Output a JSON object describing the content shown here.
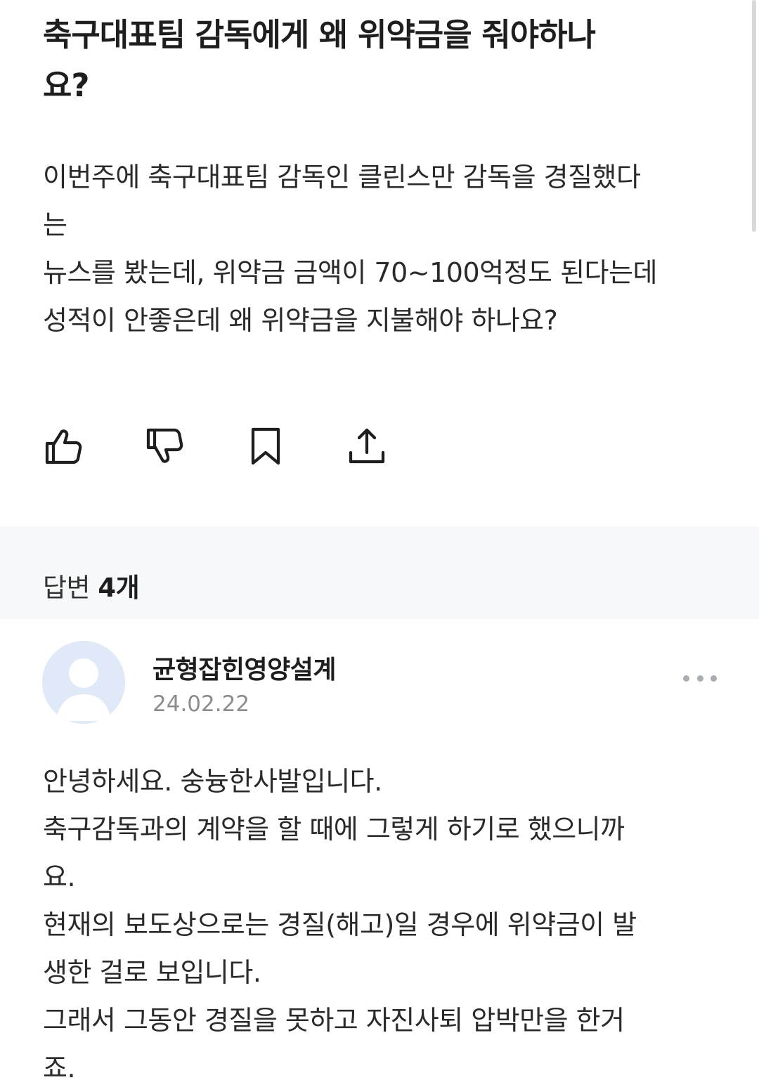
{
  "question": {
    "title_lines": [
      "축구대표팀 감독에게 왜 위약금을 줘야하나",
      "요?"
    ],
    "body_lines": [
      "이번주에 축구대표팀 감독인 클린스만 감독을 경질했다",
      "는",
      "뉴스를 봤는데, 위약금 금액이 70~100억정도 된다는데",
      "성적이 안좋은데 왜 위약금을 지불해야 하나요?"
    ]
  },
  "actions": {
    "like_icon": "thumbs-up-icon",
    "dislike_icon": "thumbs-down-icon",
    "bookmark_icon": "bookmark-icon",
    "share_icon": "share-icon"
  },
  "answers_header": {
    "label": "답변",
    "count": "4개"
  },
  "answer": {
    "author": "균형잡힌영양설계",
    "date": "24.02.22",
    "body_lines": [
      "안녕하세요. 숭늉한사발입니다.",
      "축구감독과의 계약을 할 때에 그렇게 하기로 했으니까",
      "요.",
      "현재의 보도상으로는 경질(해고)일 경우에 위약금이 발",
      "생한 걸로 보입니다.",
      "그래서 그동안 경질을 못하고 자진사퇴 압박만을 한거",
      "죠."
    ]
  },
  "colors": {
    "text": "#1e1e1e",
    "muted": "#8c8c8c",
    "band": "#f7f8f9",
    "avatar_bg": "#dfe9f7"
  }
}
